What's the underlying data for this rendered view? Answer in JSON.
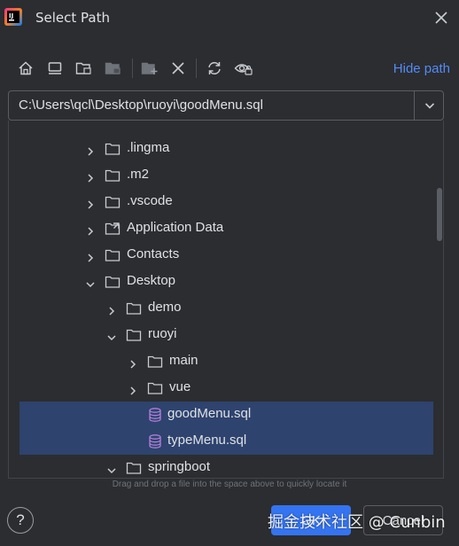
{
  "window": {
    "title": "Select Path",
    "app_icon": "intellij-idea-icon",
    "close_icon": "close-icon"
  },
  "toolbar": {
    "icons": [
      "home-icon",
      "desktop-icon",
      "project-folder-icon",
      "module-folder-icon",
      "new-folder-icon",
      "delete-icon",
      "refresh-icon",
      "show-hidden-icon"
    ],
    "hide_path_label": "Hide path"
  },
  "path": {
    "value": "C:\\Users\\qcl\\Desktop\\ruoyi\\goodMenu.sql",
    "dropdown_icon": "chevron-down-icon"
  },
  "tree": {
    "items": [
      {
        "label": ".lingma",
        "type": "folder",
        "expanded": false
      },
      {
        "label": ".m2",
        "type": "folder",
        "expanded": false
      },
      {
        "label": ".vscode",
        "type": "folder",
        "expanded": false
      },
      {
        "label": "Application Data",
        "type": "folder-link",
        "expanded": false
      },
      {
        "label": "Contacts",
        "type": "folder",
        "expanded": false
      },
      {
        "label": "Desktop",
        "type": "folder",
        "expanded": true
      },
      {
        "label": "demo",
        "type": "folder",
        "expanded": false
      },
      {
        "label": "ruoyi",
        "type": "folder",
        "expanded": true
      },
      {
        "label": "main",
        "type": "folder",
        "expanded": false
      },
      {
        "label": "vue",
        "type": "folder",
        "expanded": false
      },
      {
        "label": "goodMenu.sql",
        "type": "sql-file",
        "selected": true
      },
      {
        "label": "typeMenu.sql",
        "type": "sql-file",
        "selected": true
      },
      {
        "label": "springboot",
        "type": "folder",
        "expanded": true
      }
    ]
  },
  "hint": "Drag and drop a file into the space above to quickly locate it",
  "footer": {
    "help_label": "?",
    "ok_label": "OK",
    "cancel_label": "Cancel"
  },
  "watermark": "掘金技术社区 @ Cunbin",
  "colors": {
    "background": "#2b2d30",
    "accent": "#3574f0",
    "link": "#548af7",
    "selection": "#2e436e",
    "sql_icon": "#b07fd8"
  }
}
